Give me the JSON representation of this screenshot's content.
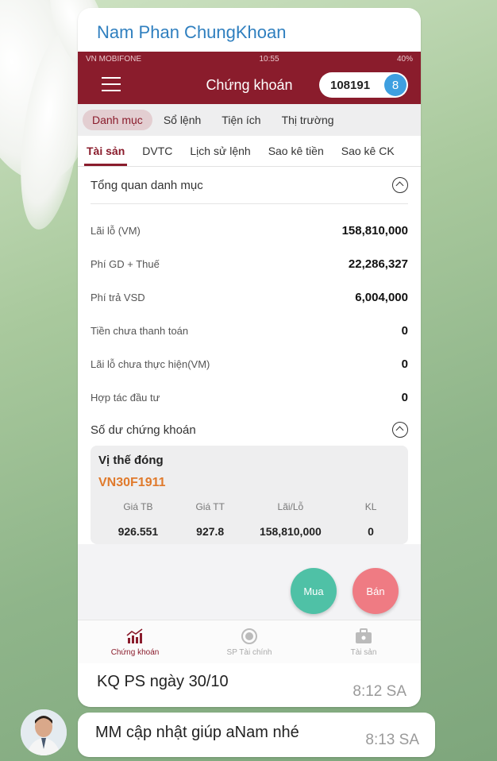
{
  "chat": {
    "sender_name": "Nam Phan ChungKhoan",
    "message1_caption": "KQ PS ngày 30/10",
    "message1_time": "8:12 SA",
    "message2_text": "MM cập nhật giúp aNam nhé",
    "message2_time": "8:13 SA"
  },
  "status_bar": {
    "carrier": "VN MOBIFONE",
    "time": "10:55",
    "battery": "40%"
  },
  "app": {
    "title": "Chứng khoán",
    "account_number": "108191",
    "account_badge": "8"
  },
  "tabs_main": [
    "Danh mục",
    "Sổ lệnh",
    "Tiện ích",
    "Thị trường"
  ],
  "tabs_sub": [
    "Tài sản",
    "DVTC",
    "Lịch sử lệnh",
    "Sao kê tiền",
    "Sao kê CK"
  ],
  "overview": {
    "title": "Tổng quan danh mục",
    "rows": [
      {
        "label": "Lãi lỗ (VM)",
        "value": "158,810,000"
      },
      {
        "label": "Phí GD + Thuế",
        "value": "22,286,327"
      },
      {
        "label": "Phí trả VSD",
        "value": "6,004,000"
      },
      {
        "label": "Tiền chưa thanh toán",
        "value": "0"
      },
      {
        "label": "Lãi lỗ chưa thực hiện(VM)",
        "value": "0"
      },
      {
        "label": "Hợp tác đầu tư",
        "value": "0"
      }
    ]
  },
  "holdings": {
    "title": "Số dư chứng khoán",
    "position_title": "Vị thế đóng",
    "code": "VN30F1911",
    "headers": [
      "Giá TB",
      "Giá TT",
      "Lãi/Lỗ",
      "KL"
    ],
    "values": [
      "926.551",
      "927.8",
      "158,810,000",
      "0"
    ]
  },
  "actions": {
    "buy": "Mua",
    "sell": "Bán"
  },
  "bottom_nav": [
    "Chứng khoán",
    "SP Tài chính",
    "Tài sản"
  ],
  "colors": {
    "primary": "#8a1c2c",
    "buy": "#4fc1a6",
    "sell": "#ef7b83",
    "code": "#e07a2c",
    "sender": "#2f7fbf"
  },
  "icons": [
    "menu-icon",
    "collapse-icon",
    "chart-icon",
    "coin-icon",
    "briefcase-icon"
  ]
}
